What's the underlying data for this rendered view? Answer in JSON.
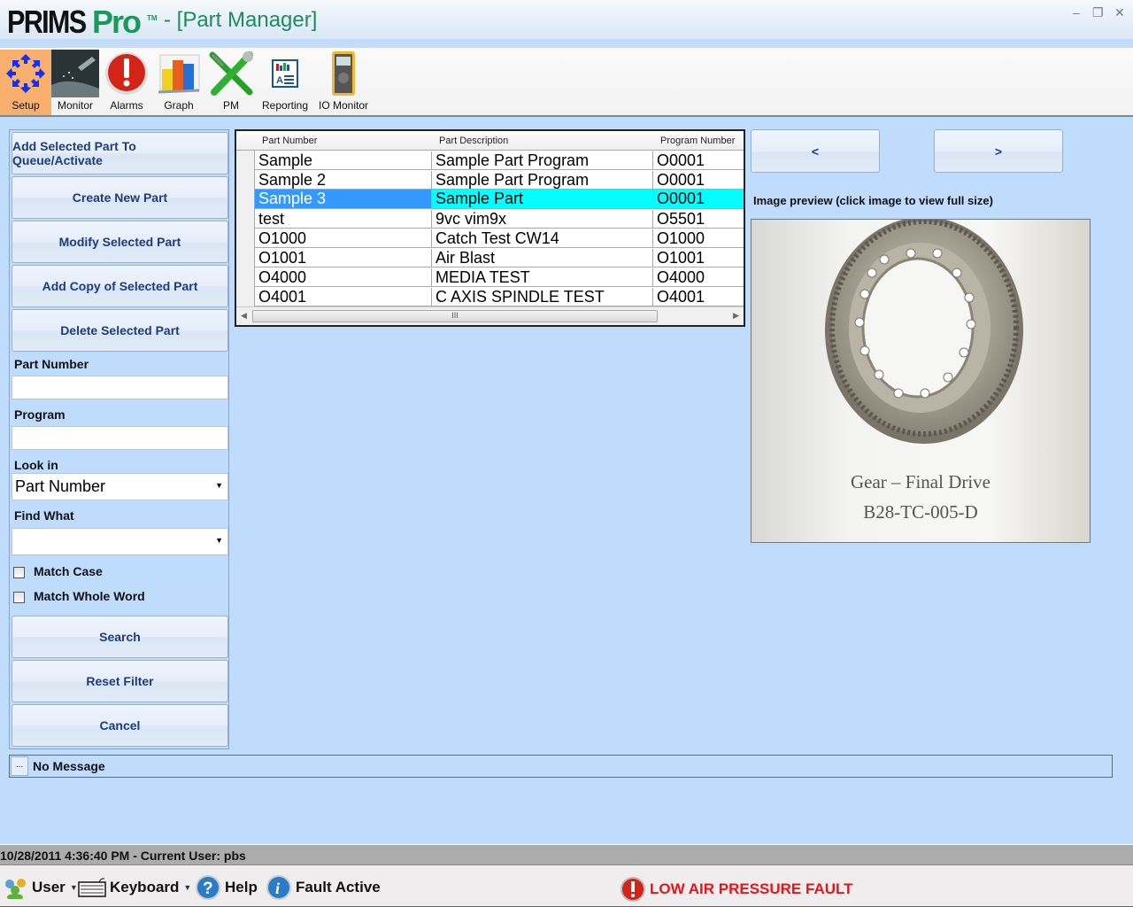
{
  "window": {
    "logo_main": "PRIMS",
    "logo_accent": "Pro",
    "logo_tm": "TM",
    "title": "- [Part Manager]",
    "controls": {
      "minimize": "–",
      "restore": "❐",
      "close": "✕"
    }
  },
  "toolbar": {
    "items": [
      {
        "label": "Setup",
        "icon": "setup-arrows-icon",
        "active": true
      },
      {
        "label": "Monitor",
        "icon": "monitor-machining-icon"
      },
      {
        "label": "Alarms",
        "icon": "alarm-exclamation-icon"
      },
      {
        "label": "Graph",
        "icon": "bar-graph-icon"
      },
      {
        "label": "PM",
        "icon": "wrench-screwdriver-icon"
      },
      {
        "label": "Reporting",
        "icon": "report-icon"
      },
      {
        "label": "IO Monitor",
        "icon": "multimeter-icon"
      }
    ]
  },
  "actions": {
    "add_to_queue": "Add Selected Part To Queue/Activate",
    "create_new": "Create New Part",
    "modify": "Modify Selected Part",
    "add_copy": "Add Copy of Selected Part",
    "delete": "Delete Selected Part"
  },
  "search": {
    "part_number_label": "Part Number",
    "part_number_value": "",
    "program_label": "Program",
    "program_value": "",
    "look_in_label": "Look in",
    "look_in_value": "Part Number",
    "find_what_label": "Find What",
    "find_what_value": "",
    "match_case_label": "Match Case",
    "match_case_checked": false,
    "match_whole_word_label": "Match Whole Word",
    "match_whole_word_checked": false,
    "search_button": "Search",
    "reset_button": "Reset Filter",
    "cancel_button": "Cancel"
  },
  "grid": {
    "columns": [
      "Part Number",
      "Part Description",
      "Program Number"
    ],
    "selected_index": 2,
    "rows": [
      [
        "Sample",
        "Sample Part Program",
        "O0001"
      ],
      [
        "Sample 2",
        "Sample Part Program",
        "O0001"
      ],
      [
        "Sample 3",
        "Sample Part",
        "O0001"
      ],
      [
        "test",
        "9vc vim9x",
        "O5501"
      ],
      [
        "O1000",
        "Catch Test  CW14",
        "O1000"
      ],
      [
        "O1001",
        "Air Blast",
        "O1001"
      ],
      [
        "O4000",
        "MEDIA TEST",
        "O4000"
      ],
      [
        "O4001",
        "C AXIS SPINDLE TEST",
        "O4001"
      ]
    ],
    "scroll_grip": "III"
  },
  "preview": {
    "prev_button": "<",
    "next_button": ">",
    "label": "Image preview (click image to view full size)",
    "caption_line1": "Gear – Final Drive",
    "caption_line2": "B28-TC-005-D"
  },
  "message": {
    "dots": "...",
    "text": "No Message"
  },
  "status": {
    "text": "10/28/2011 4:36:40 PM - Current User:  pbs"
  },
  "bottom": {
    "user": "User",
    "keyboard": "Keyboard",
    "help": "Help",
    "fault_active": "Fault Active",
    "fault_message": "LOW AIR PRESSURE FAULT",
    "fault_color": "#e8141a"
  }
}
